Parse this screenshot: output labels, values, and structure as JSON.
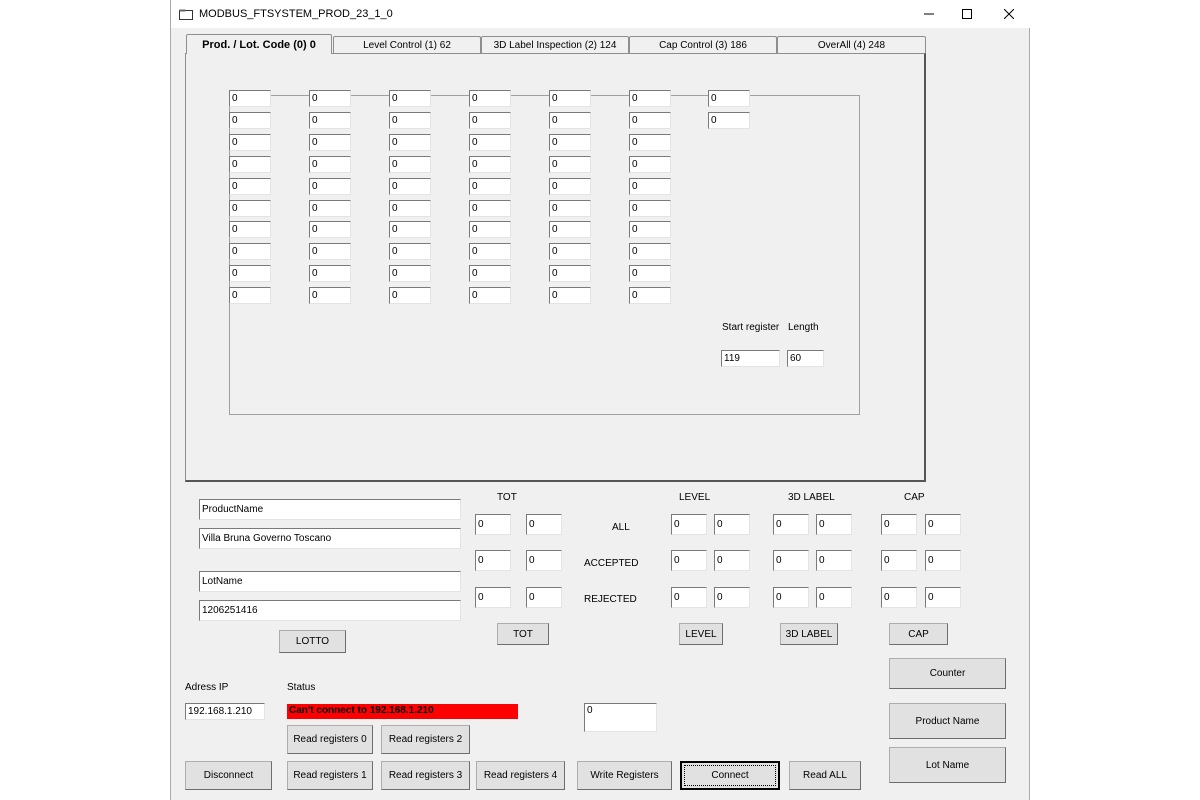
{
  "window": {
    "title": "MODBUS_FTSYSTEM_PROD_23_1_0"
  },
  "tabs": [
    {
      "label": "Prod. / Lot. Code (0) 0"
    },
    {
      "label": "Level Control (1) 62"
    },
    {
      "label": "3D Label Inspection (2) 124"
    },
    {
      "label": "Cap Control (3) 186"
    },
    {
      "label": "OverAll (4) 248"
    }
  ],
  "grid": {
    "columns": [
      [
        "0",
        "0",
        "0",
        "0",
        "0",
        "0",
        "0",
        "0",
        "0",
        "0"
      ],
      [
        "0",
        "0",
        "0",
        "0",
        "0",
        "0",
        "0",
        "0",
        "0",
        "0"
      ],
      [
        "0",
        "0",
        "0",
        "0",
        "0",
        "0",
        "0",
        "0",
        "0",
        "0"
      ],
      [
        "0",
        "0",
        "0",
        "0",
        "0",
        "0",
        "0",
        "0",
        "0",
        "0"
      ],
      [
        "0",
        "0",
        "0",
        "0",
        "0",
        "0",
        "0",
        "0",
        "0",
        "0"
      ],
      [
        "0",
        "0",
        "0",
        "0",
        "0",
        "0",
        "0",
        "0",
        "0",
        "0"
      ],
      [
        "0",
        "0"
      ]
    ]
  },
  "register": {
    "start_label": "Start register",
    "length_label": "Length",
    "start_value": "119",
    "length_value": "60"
  },
  "product": {
    "name_label": "ProductName",
    "name_value": "Villa Bruna Governo Toscano",
    "lot_label": "LotName",
    "lot_value": "1206251416",
    "lotto_button": "LOTTO"
  },
  "counters": {
    "headers": {
      "tot": "TOT",
      "level": "LEVEL",
      "label3d": "3D LABEL",
      "cap": "CAP"
    },
    "rows": [
      "ALL",
      "ACCEPTED",
      "REJECTED"
    ],
    "values": {
      "tot": [
        [
          "0",
          "0"
        ],
        [
          "0",
          "0"
        ],
        [
          "0",
          "0"
        ]
      ],
      "level": [
        [
          "0",
          "0"
        ],
        [
          "0",
          "0"
        ],
        [
          "0",
          "0"
        ]
      ],
      "label3d": [
        [
          "0",
          "0"
        ],
        [
          "0",
          "0"
        ],
        [
          "0",
          "0"
        ]
      ],
      "cap": [
        [
          "0",
          "0"
        ],
        [
          "0",
          "0"
        ],
        [
          "0",
          "0"
        ]
      ]
    },
    "buttons": {
      "tot": "TOT",
      "level": "LEVEL",
      "label3d": "3D LABEL",
      "cap": "CAP"
    }
  },
  "side_buttons": {
    "counter": "Counter",
    "product_name": "Product Name",
    "lot_name": "Lot Name"
  },
  "connection": {
    "ip_label": "Adress IP",
    "ip_value": "192.168.1.210",
    "status_label": "Status",
    "status_text": "Can't connect to 192.168.1.210",
    "status_color": "#ff0000",
    "write_value": "0"
  },
  "bottom_buttons": {
    "read0": "Read registers 0",
    "read2": "Read registers 2",
    "disconnect": "Disconnect",
    "read1": "Read registers 1",
    "read3": "Read registers 3",
    "read4": "Read registers 4",
    "write": "Write Registers",
    "connect": "Connect",
    "read_all": "Read ALL"
  }
}
